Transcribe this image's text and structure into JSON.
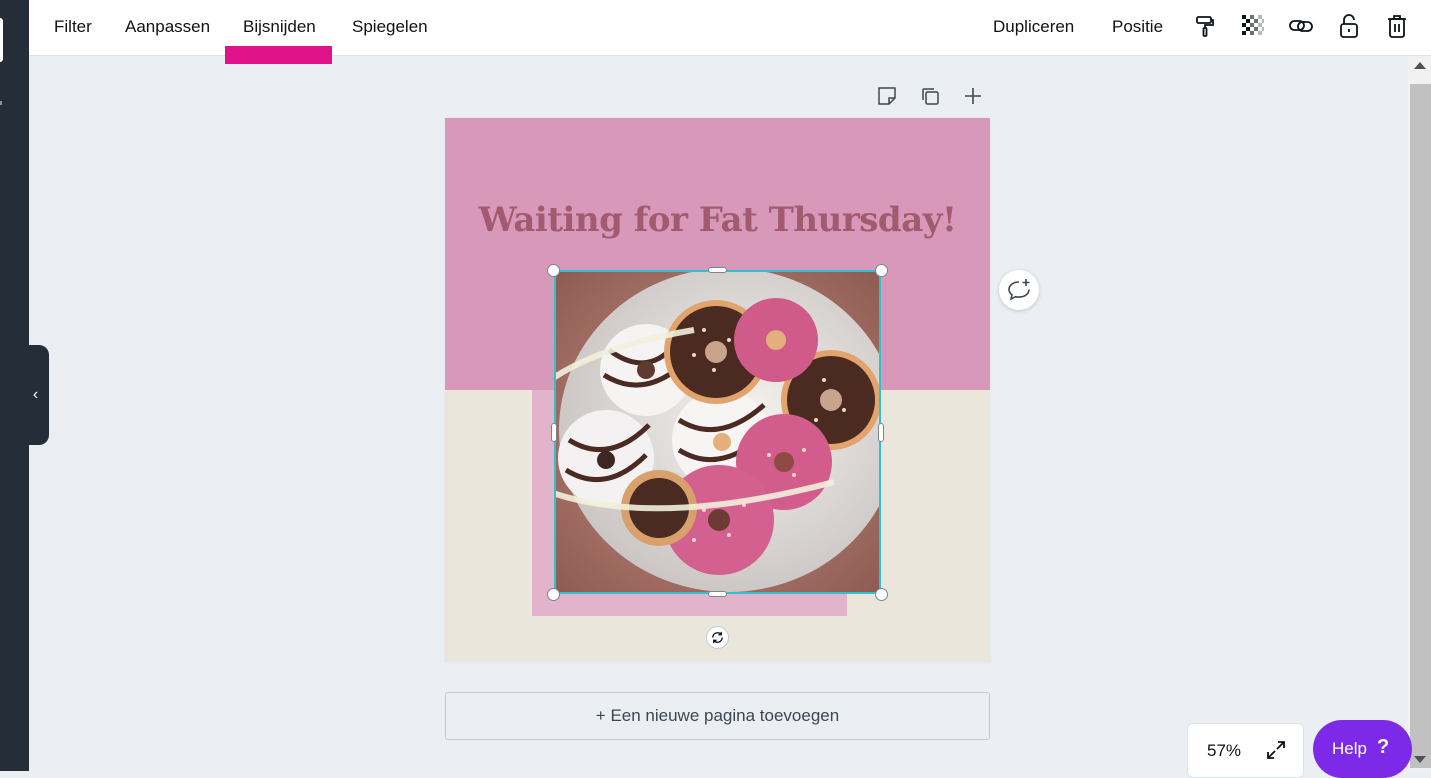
{
  "toolbar": {
    "tabs": [
      {
        "label": "Filter"
      },
      {
        "label": "Aanpassen"
      },
      {
        "label": "Bijsnijden"
      },
      {
        "label": "Spiegelen"
      }
    ],
    "active_tab": "Bijsnijden",
    "active_color": "#e0128a",
    "right_actions": {
      "duplicate_label": "Dupliceren",
      "position_label": "Positie"
    },
    "icons": [
      "paint-roller-icon",
      "transparency-icon",
      "link-icon",
      "lock-icon",
      "trash-icon"
    ]
  },
  "page_actions": {
    "icons": [
      "note-icon",
      "duplicate-page-icon",
      "add-page-plus-icon"
    ]
  },
  "design": {
    "title": "Waiting for Fat Thursday!",
    "colors": {
      "pink_top": "#d898ba",
      "cream_bottom": "#ebe6dc",
      "pink_rect": "#e2b4cc",
      "title_color": "#a25a6e",
      "selection": "#2fc3d1"
    },
    "image_subject": "bowl of donuts"
  },
  "add_page_label": "+ Een nieuwe pagina toevoegen",
  "zoom": {
    "value": "57%"
  },
  "help": {
    "label": "Help",
    "symbol": "?"
  },
  "sidebar": {
    "collapse_glyph": "‹"
  },
  "scrollbar": {
    "color": "#c1c1c1"
  }
}
